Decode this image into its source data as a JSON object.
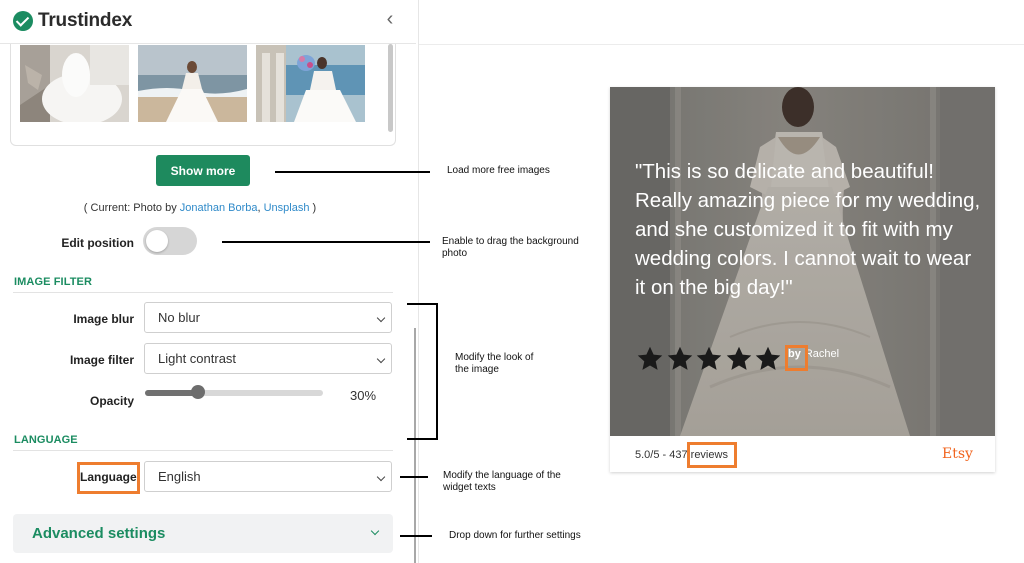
{
  "brand": {
    "name": "Trustindex",
    "accent": "#1b8c61"
  },
  "panel": {
    "show_more_label": "Show more",
    "credit": {
      "prefix": "( Current: Photo by ",
      "author": "Jonathan Borba",
      "separator": ", ",
      "source": "Unsplash",
      "suffix": " )"
    },
    "edit_position_label": "Edit position",
    "edit_position_on": false,
    "image_filter_title": "IMAGE FILTER",
    "image_blur_label": "Image blur",
    "image_blur_value": "No blur",
    "image_filter_label": "Image filter",
    "image_filter_value": "Light contrast",
    "opacity_label": "Opacity",
    "opacity_value": "30%",
    "opacity_fraction": 0.3,
    "language_title": "LANGUAGE",
    "language_label": "Language",
    "language_value": "English",
    "advanced_label": "Advanced settings"
  },
  "annotations": {
    "show_more": "Load more free images",
    "edit_position": "Enable to drag the background photo",
    "filters": "Modify the look of the image",
    "language": "Modify the language of the widget texts",
    "advanced": "Drop down for further settings",
    "highlight_color": "#ee7d2f"
  },
  "widget": {
    "review_text": "\"This is so delicate and beautiful! Really amazing piece for my wedding, and she customized it to fit with my wedding colors. I cannot wait to wear it on the big day!\"",
    "stars": 5,
    "by_label": "by",
    "author": "Rachel",
    "rating_prefix": "5.0/5 - 437 ",
    "reviews_label": "reviews",
    "platform": "Etsy",
    "platform_color": "#f1641e"
  }
}
